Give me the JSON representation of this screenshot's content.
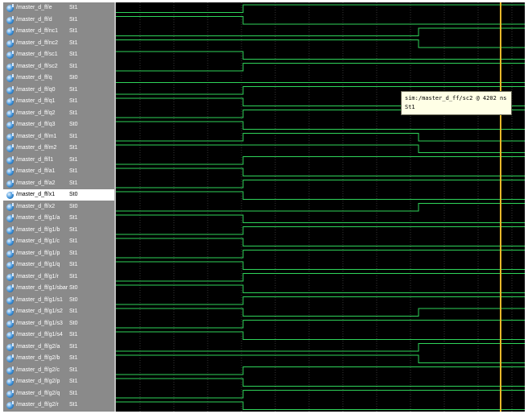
{
  "colors": {
    "waveform": "#2fd45a",
    "cursor": "#e8b82a",
    "grid": "#5a5a5a",
    "signal_panel_bg": "#8a8a8a",
    "wave_bg": "#000000"
  },
  "signals": [
    {
      "name": "/master_d_ff/e",
      "value": "St1",
      "selected": false
    },
    {
      "name": "/master_d_ff/d",
      "value": "St1",
      "selected": false
    },
    {
      "name": "/master_d_ff/nc1",
      "value": "St1",
      "selected": false
    },
    {
      "name": "/master_d_ff/nc2",
      "value": "St1",
      "selected": false
    },
    {
      "name": "/master_d_ff/sc1",
      "value": "St1",
      "selected": false
    },
    {
      "name": "/master_d_ff/sc2",
      "value": "St1",
      "selected": false
    },
    {
      "name": "/master_d_ff/q",
      "value": "St0",
      "selected": false
    },
    {
      "name": "/master_d_ff/q0",
      "value": "St1",
      "selected": false
    },
    {
      "name": "/master_d_ff/q1",
      "value": "St1",
      "selected": false
    },
    {
      "name": "/master_d_ff/q2",
      "value": "St1",
      "selected": false
    },
    {
      "name": "/master_d_ff/q3",
      "value": "St0",
      "selected": false
    },
    {
      "name": "/master_d_ff/m1",
      "value": "St1",
      "selected": false
    },
    {
      "name": "/master_d_ff/m2",
      "value": "St1",
      "selected": false
    },
    {
      "name": "/master_d_ff/l1",
      "value": "St1",
      "selected": false
    },
    {
      "name": "/master_d_ff/a1",
      "value": "St1",
      "selected": false
    },
    {
      "name": "/master_d_ff/a2",
      "value": "St1",
      "selected": false
    },
    {
      "name": "/master_d_ff/x1",
      "value": "St0",
      "selected": true
    },
    {
      "name": "/master_d_ff/x2",
      "value": "St0",
      "selected": false
    },
    {
      "name": "/master_d_ff/g1/a",
      "value": "St1",
      "selected": false
    },
    {
      "name": "/master_d_ff/g1/b",
      "value": "St1",
      "selected": false
    },
    {
      "name": "/master_d_ff/g1/c",
      "value": "St1",
      "selected": false
    },
    {
      "name": "/master_d_ff/g1/p",
      "value": "St1",
      "selected": false
    },
    {
      "name": "/master_d_ff/g1/q",
      "value": "St1",
      "selected": false
    },
    {
      "name": "/master_d_ff/g1/r",
      "value": "St1",
      "selected": false
    },
    {
      "name": "/master_d_ff/g1/sbar",
      "value": "St0",
      "selected": false
    },
    {
      "name": "/master_d_ff/g1/s1",
      "value": "St0",
      "selected": false
    },
    {
      "name": "/master_d_ff/g1/s2",
      "value": "St1",
      "selected": false
    },
    {
      "name": "/master_d_ff/g1/s3",
      "value": "St0",
      "selected": false
    },
    {
      "name": "/master_d_ff/g1/s4",
      "value": "St1",
      "selected": false
    },
    {
      "name": "/master_d_ff/g2/a",
      "value": "St1",
      "selected": false
    },
    {
      "name": "/master_d_ff/g2/b",
      "value": "St1",
      "selected": false
    },
    {
      "name": "/master_d_ff/g2/c",
      "value": "St1",
      "selected": false
    },
    {
      "name": "/master_d_ff/g2/p",
      "value": "St1",
      "selected": false
    },
    {
      "name": "/master_d_ff/g2/q",
      "value": "St1",
      "selected": false
    },
    {
      "name": "/master_d_ff/g2/r",
      "value": "St1",
      "selected": false
    }
  ],
  "tooltip": {
    "line1": "sim:/master_d_ff/sc2 @ 4202 ns",
    "line2": "St1"
  }
}
